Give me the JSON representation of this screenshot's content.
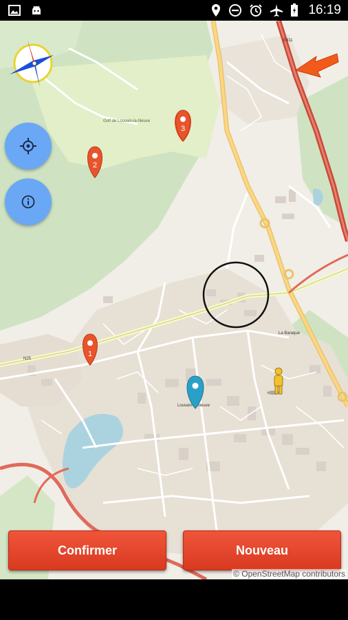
{
  "status_bar": {
    "time": "16:19",
    "left_icons": [
      "image-icon",
      "android-icon"
    ],
    "right_icons": [
      "location-icon",
      "do-not-disturb-icon",
      "alarm-icon",
      "airplane-icon",
      "battery-icon"
    ]
  },
  "map": {
    "attribution": "© OpenStreetMap contributors",
    "labels": {
      "town": "Louvain-la-Neuve",
      "place": "Golf de Louvain-la-Neuve",
      "road": "N25",
      "area": "La Baraque",
      "motorway": "E411"
    },
    "markers": [
      {
        "label": "1",
        "color": "#e8542c"
      },
      {
        "label": "2",
        "color": "#e8542c"
      },
      {
        "label": "3",
        "color": "#e8542c"
      },
      {
        "label": "",
        "color": "#2aa0c8"
      }
    ]
  },
  "controls": {
    "compass": "compass-icon",
    "locate": "crosshair-icon",
    "info": "info-icon"
  },
  "buttons": {
    "confirm": "Confirmer",
    "new": "Nouveau"
  },
  "colors": {
    "button": "#e84a2e",
    "fab": "#6aa8f6",
    "arrow": "#f25a1a"
  }
}
